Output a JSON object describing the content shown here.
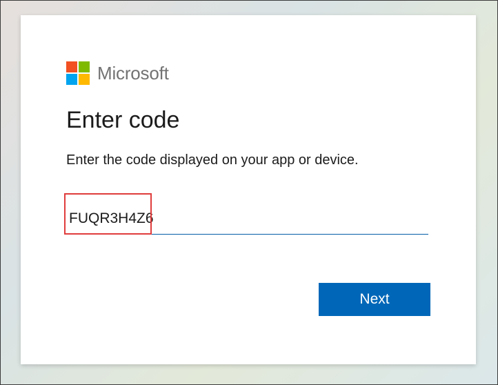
{
  "brand": {
    "name": "Microsoft",
    "logo_colors": [
      "#f25022",
      "#7fba00",
      "#00a4ef",
      "#ffb900"
    ]
  },
  "form": {
    "title": "Enter code",
    "instruction": "Enter the code displayed on your app or device.",
    "code_value": "FUQR3H4Z6",
    "next_label": "Next"
  },
  "colors": {
    "accent": "#0067b8",
    "highlight": "#e03c3c"
  }
}
